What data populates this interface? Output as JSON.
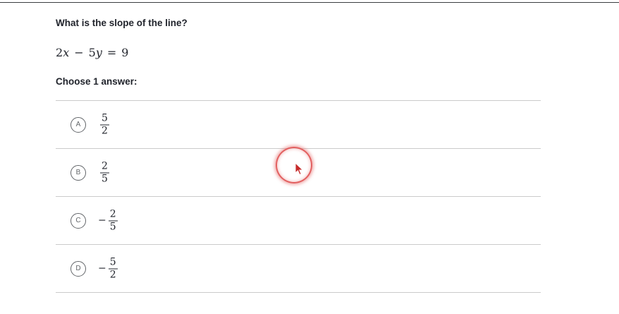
{
  "question": {
    "prompt": "What is the slope of the line?",
    "equation": {
      "coef_x": "2",
      "var_x": "x",
      "minus": "−",
      "coef_y": "5",
      "var_y": "y",
      "equals": "=",
      "rhs": "9"
    },
    "choose_label": "Choose 1 answer:"
  },
  "choices": [
    {
      "letter": "A",
      "sign": "",
      "numerator": "5",
      "denominator": "2"
    },
    {
      "letter": "B",
      "sign": "",
      "numerator": "2",
      "denominator": "5"
    },
    {
      "letter": "C",
      "sign": "−",
      "numerator": "2",
      "denominator": "5"
    },
    {
      "letter": "D",
      "sign": "−",
      "numerator": "5",
      "denominator": "2"
    }
  ],
  "icons": {
    "pointer": "mouse-pointer-icon",
    "click_highlight": "click-highlight-icon"
  },
  "colors": {
    "text": "#21242c",
    "divider": "#cbcbcb",
    "letter_circle": "#626569",
    "cursor_highlight": "#dd4444"
  }
}
